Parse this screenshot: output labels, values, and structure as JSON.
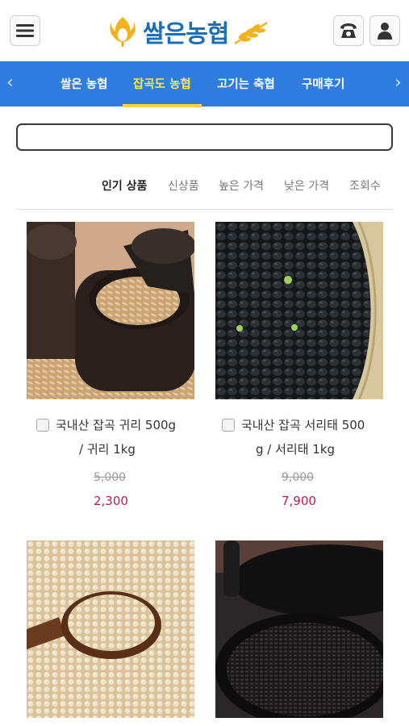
{
  "header": {
    "logo_text": "쌀은농협",
    "icons": [
      "hamburger-menu-icon",
      "phone-icon",
      "user-icon",
      "rice-logo-icon",
      "wheat-icon"
    ]
  },
  "nav": {
    "items": [
      {
        "label": "쌀은 농협",
        "active": false
      },
      {
        "label": "잡곡도 농협",
        "active": true
      },
      {
        "label": "고기는 축협",
        "active": false
      },
      {
        "label": "구매후기",
        "active": false
      }
    ],
    "prev_arrow": "‹",
    "next_arrow": "›",
    "accent": "#2f7de0",
    "active_color": "#ffe45c"
  },
  "search": {
    "value": "",
    "placeholder": ""
  },
  "sort": {
    "options": [
      {
        "label": "인기 상품",
        "active": true
      },
      {
        "label": "신상품",
        "active": false
      },
      {
        "label": "높은 가격",
        "active": false
      },
      {
        "label": "낮은 가격",
        "active": false
      },
      {
        "label": "조회수",
        "active": false
      }
    ]
  },
  "products": [
    {
      "title_line1": "국내산 잡곡 귀리 500g",
      "title_line2": "/ 귀리 1kg",
      "original_price": "5,000",
      "sale_price": "2,300"
    },
    {
      "title_line1": "국내산 잡곡 서리태 500",
      "title_line2": "g / 서리태 1kg",
      "original_price": "9,000",
      "sale_price": "7,900"
    },
    {
      "title_line1": "",
      "title_line2": "",
      "original_price": "",
      "sale_price": ""
    },
    {
      "title_line1": "",
      "title_line2": "",
      "original_price": "",
      "sale_price": ""
    }
  ],
  "colors": {
    "sale_price": "#c2185b",
    "nav_bg": "#2f7de0",
    "logo_blue": "#1b6fb8",
    "logo_yellow": "#f3b21b"
  }
}
